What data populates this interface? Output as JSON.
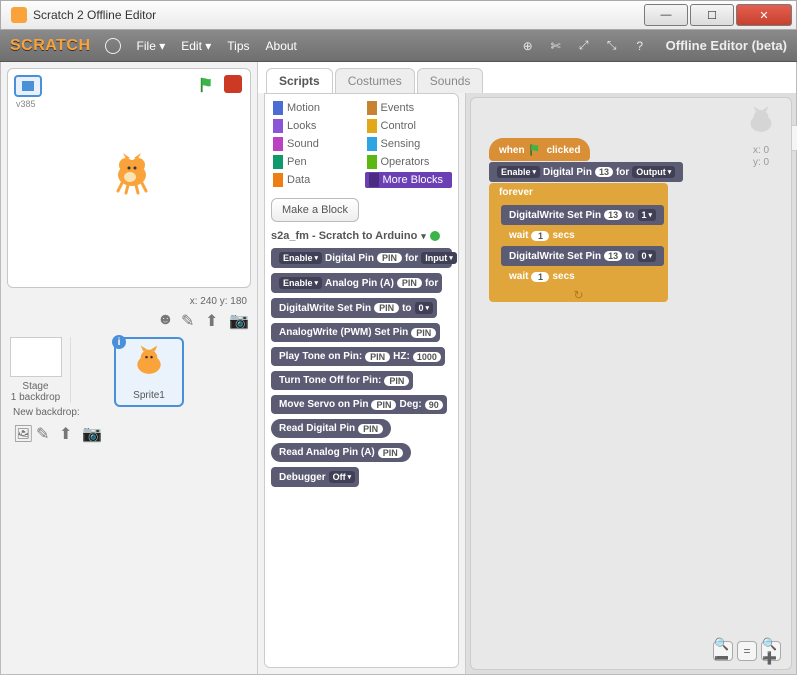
{
  "window": {
    "title": "Scratch 2 Offline Editor"
  },
  "brand": "SCRATCH",
  "menu": {
    "file": "File ▾",
    "edit": "Edit ▾",
    "tips": "Tips",
    "about": "About",
    "offline": "Offline Editor (beta)"
  },
  "stage": {
    "vlabel": "v385",
    "coords": "x: 240  y: 180",
    "stage_lbl": "Stage",
    "backdrop_lbl": "1 backdrop",
    "newbackdrop": "New backdrop:",
    "sprite_name": "Sprite1"
  },
  "tabs": {
    "scripts": "Scripts",
    "costumes": "Costumes",
    "sounds": "Sounds"
  },
  "categories": {
    "motion": "Motion",
    "looks": "Looks",
    "sound": "Sound",
    "pen": "Pen",
    "data": "Data",
    "events": "Events",
    "control": "Control",
    "sensing": "Sensing",
    "operators": "Operators",
    "more": "More Blocks"
  },
  "make_block": "Make a Block",
  "extension": {
    "title": "s2a_fm - Scratch to Arduino"
  },
  "palette": {
    "b1a": "Enable",
    "b1b": "Digital Pin",
    "b1c": "PIN",
    "b1d": "for",
    "b1e": "Input",
    "b2a": "Enable",
    "b2b": "Analog Pin (A)",
    "b2c": "PIN",
    "b2d": "for",
    "b3a": "DigitalWrite Set Pin",
    "b3b": "PIN",
    "b3c": "to",
    "b3d": "0",
    "b4a": "AnalogWrite (PWM) Set Pin",
    "b4b": "PIN",
    "b5a": "Play Tone on Pin:",
    "b5b": "PIN",
    "b5c": "HZ:",
    "b5d": "1000",
    "b6a": "Turn Tone Off for Pin:",
    "b6b": "PIN",
    "b7a": "Move Servo on Pin",
    "b7b": "PIN",
    "b7c": "Deg:",
    "b7d": "90",
    "b8a": "Read Digital Pin",
    "b8b": "PIN",
    "b9a": "Read Analog Pin (A)",
    "b9b": "PIN",
    "b10a": "Debugger",
    "b10b": "Off"
  },
  "scriptinfo": {
    "xlabel": "x: 0",
    "ylabel": "y: 0"
  },
  "script": {
    "hat_a": "when",
    "hat_b": "clicked",
    "s1a": "Enable",
    "s1b": "Digital Pin",
    "s1c": "13",
    "s1d": "for",
    "s1e": "Output",
    "forever": "forever",
    "s2a": "DigitalWrite Set Pin",
    "s2b": "13",
    "s2c": "to",
    "s2d": "1",
    "wait_a": "wait",
    "wait_b": "1",
    "wait_c": "secs",
    "s3a": "DigitalWrite Set Pin",
    "s3b": "13",
    "s3c": "to",
    "s3d": "0",
    "loop_arrow": "↻"
  },
  "colors": {
    "motion": "#4a6cd4",
    "looks": "#8a55d7",
    "sound": "#bb42c3",
    "pen": "#0e9a6c",
    "data": "#ee7d16",
    "events": "#c88330",
    "control": "#e1a91a",
    "sensing": "#2ca5e2",
    "operators": "#5cb712",
    "more": "#6b40b5"
  }
}
